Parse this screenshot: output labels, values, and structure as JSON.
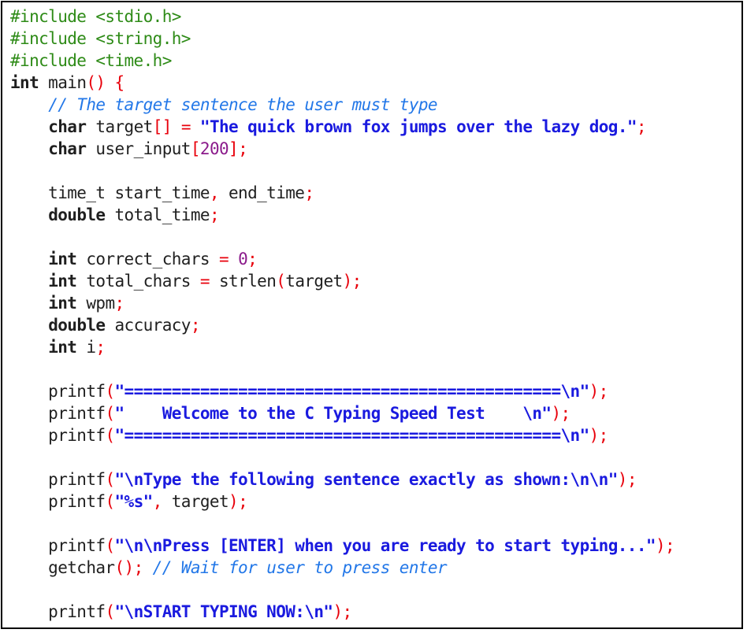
{
  "colors": {
    "preprocessor": "#2e8b17",
    "keyword": "#1f1f1f",
    "identifier": "#1f1f1f",
    "punctuation": "#e8000b",
    "string": "#1a1adf",
    "number": "#8b1a8b",
    "comment": "#2277e8",
    "background": "#ffffff",
    "border": "#000000"
  },
  "code_lines": [
    [
      [
        "pre",
        "#include <stdio.h>"
      ]
    ],
    [
      [
        "pre",
        "#include <string.h>"
      ]
    ],
    [
      [
        "pre",
        "#include <time.h>"
      ]
    ],
    [
      [
        "kw",
        "int"
      ],
      [
        "id",
        " main"
      ],
      [
        "pun",
        "() {"
      ]
    ],
    [
      [
        "id",
        "    "
      ],
      [
        "com",
        "// The target sentence the user must type"
      ]
    ],
    [
      [
        "id",
        "    "
      ],
      [
        "kw",
        "char"
      ],
      [
        "id",
        " target"
      ],
      [
        "pun",
        "[]"
      ],
      [
        "id",
        " "
      ],
      [
        "pun",
        "="
      ],
      [
        "id",
        " "
      ],
      [
        "str",
        "\"The quick brown fox jumps over the lazy dog.\""
      ],
      [
        "pun",
        ";"
      ]
    ],
    [
      [
        "id",
        "    "
      ],
      [
        "kw",
        "char"
      ],
      [
        "id",
        " user_input"
      ],
      [
        "pun",
        "["
      ],
      [
        "num",
        "200"
      ],
      [
        "pun",
        "];"
      ]
    ],
    [],
    [
      [
        "id",
        "    time_t start_time"
      ],
      [
        "pun",
        ","
      ],
      [
        "id",
        " end_time"
      ],
      [
        "pun",
        ";"
      ]
    ],
    [
      [
        "id",
        "    "
      ],
      [
        "kw",
        "double"
      ],
      [
        "id",
        " total_time"
      ],
      [
        "pun",
        ";"
      ]
    ],
    [],
    [
      [
        "id",
        "    "
      ],
      [
        "kw",
        "int"
      ],
      [
        "id",
        " correct_chars "
      ],
      [
        "pun",
        "="
      ],
      [
        "id",
        " "
      ],
      [
        "num",
        "0"
      ],
      [
        "pun",
        ";"
      ]
    ],
    [
      [
        "id",
        "    "
      ],
      [
        "kw",
        "int"
      ],
      [
        "id",
        " total_chars "
      ],
      [
        "pun",
        "="
      ],
      [
        "id",
        " strlen"
      ],
      [
        "pun",
        "("
      ],
      [
        "id",
        "target"
      ],
      [
        "pun",
        ");"
      ]
    ],
    [
      [
        "id",
        "    "
      ],
      [
        "kw",
        "int"
      ],
      [
        "id",
        " wpm"
      ],
      [
        "pun",
        ";"
      ]
    ],
    [
      [
        "id",
        "    "
      ],
      [
        "kw",
        "double"
      ],
      [
        "id",
        " accuracy"
      ],
      [
        "pun",
        ";"
      ]
    ],
    [
      [
        "id",
        "    "
      ],
      [
        "kw",
        "int"
      ],
      [
        "id",
        " i"
      ],
      [
        "pun",
        ";"
      ]
    ],
    [],
    [
      [
        "id",
        "    printf"
      ],
      [
        "pun",
        "("
      ],
      [
        "str",
        "\"==============================================\\n\""
      ],
      [
        "pun",
        ");"
      ]
    ],
    [
      [
        "id",
        "    printf"
      ],
      [
        "pun",
        "("
      ],
      [
        "str",
        "\"    Welcome to the C Typing Speed Test    \\n\""
      ],
      [
        "pun",
        ");"
      ]
    ],
    [
      [
        "id",
        "    printf"
      ],
      [
        "pun",
        "("
      ],
      [
        "str",
        "\"==============================================\\n\""
      ],
      [
        "pun",
        ");"
      ]
    ],
    [],
    [
      [
        "id",
        "    printf"
      ],
      [
        "pun",
        "("
      ],
      [
        "str",
        "\"\\nType the following sentence exactly as shown:\\n\\n\""
      ],
      [
        "pun",
        ");"
      ]
    ],
    [
      [
        "id",
        "    printf"
      ],
      [
        "pun",
        "("
      ],
      [
        "str",
        "\"%s\""
      ],
      [
        "pun",
        ","
      ],
      [
        "id",
        " target"
      ],
      [
        "pun",
        ");"
      ]
    ],
    [],
    [
      [
        "id",
        "    printf"
      ],
      [
        "pun",
        "("
      ],
      [
        "str",
        "\"\\n\\nPress [ENTER] when you are ready to start typing...\""
      ],
      [
        "pun",
        ");"
      ]
    ],
    [
      [
        "id",
        "    getchar"
      ],
      [
        "pun",
        "();"
      ],
      [
        "id",
        " "
      ],
      [
        "com",
        "// Wait for user to press enter"
      ]
    ],
    [],
    [
      [
        "id",
        "    printf"
      ],
      [
        "pun",
        "("
      ],
      [
        "str",
        "\"\\nSTART TYPING NOW:\\n\""
      ],
      [
        "pun",
        ");"
      ]
    ]
  ]
}
